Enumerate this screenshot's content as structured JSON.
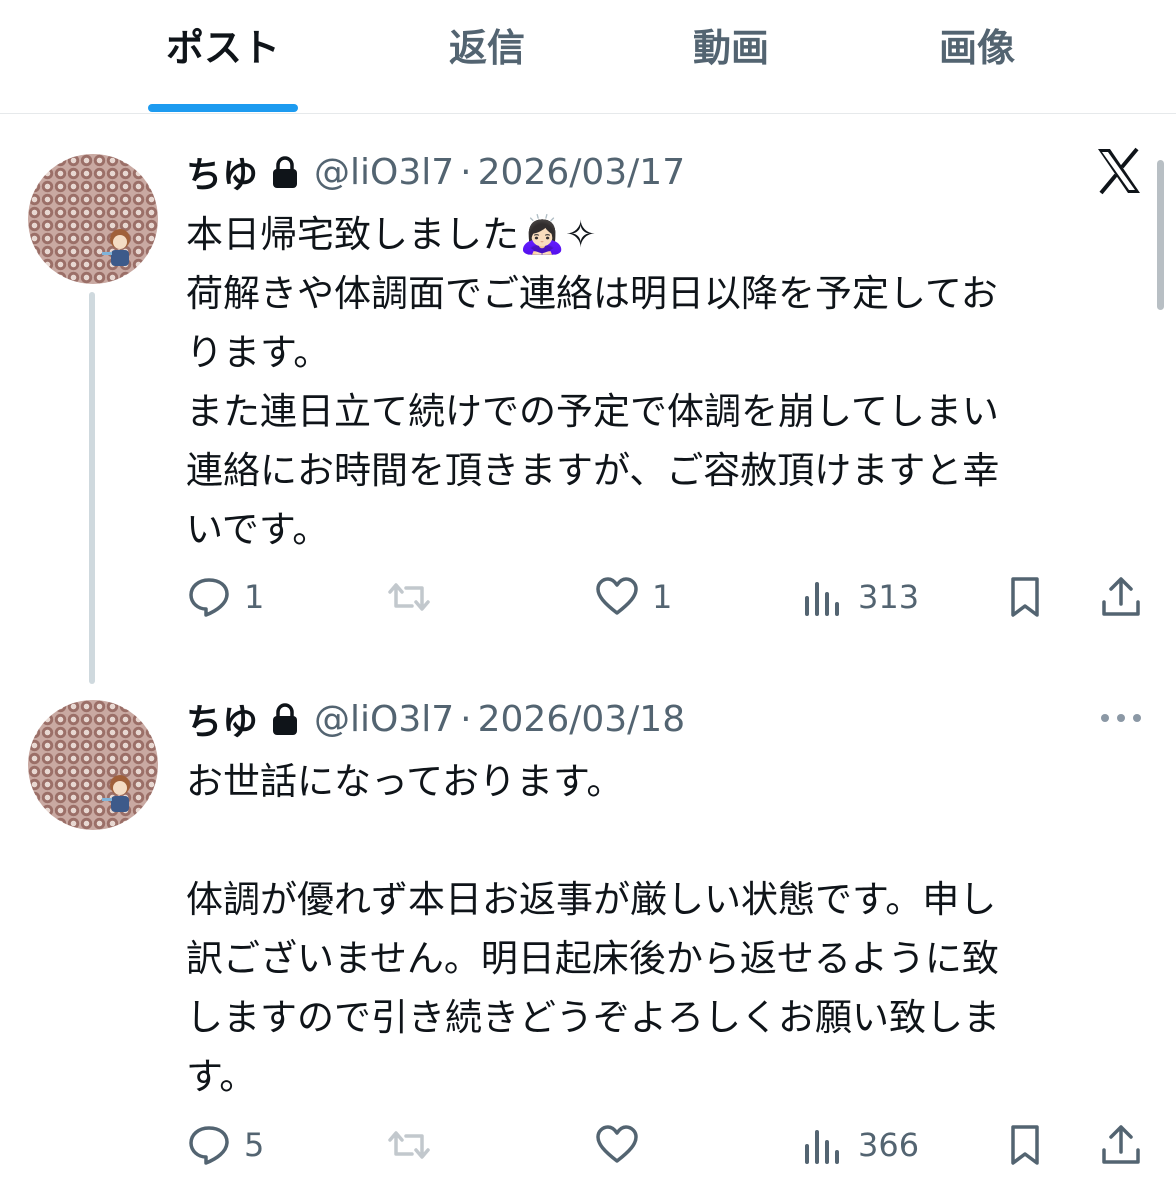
{
  "tabs": [
    {
      "label": "ポスト",
      "active": true
    },
    {
      "label": "返信",
      "active": false
    },
    {
      "label": "動画",
      "active": false
    },
    {
      "label": "画像",
      "active": false
    }
  ],
  "colors": {
    "accent": "#1d9bf0",
    "text": "#0f1419",
    "muted": "#536471"
  },
  "posts": [
    {
      "name": "ちゆ",
      "handle": "@liO3l7",
      "separator": "·",
      "date": "2026/03/17",
      "icons": [
        "lock-icon",
        "x-logo-icon",
        "person-bowing-emoji",
        "sparkle-icon"
      ],
      "text": "本日帰宅致しました🙇🏻‍♀️✧\n荷解きや体調面でご連絡は明日以降を予定してお\nります。\nまた連日立て続けでの予定で体調を崩してしまい\n連絡にお時間を頂きますが、ご容赦頂けますと幸\nいです。",
      "replies": "1",
      "reposts": "",
      "likes": "1",
      "views": "313"
    },
    {
      "name": "ちゆ",
      "handle": "@liO3l7",
      "separator": "·",
      "date": "2026/03/18",
      "icons": [
        "lock-icon",
        "more-icon"
      ],
      "text": "お世話になっております。\n\n体調が優れず本日お返事が厳しい状態です。申し\n訳ございません。明日起床後から返せるように致\nしますので引き続きどうぞよろしくお願い致しま\nす。",
      "replies": "5",
      "reposts": "",
      "likes": "",
      "views": "366"
    }
  ]
}
